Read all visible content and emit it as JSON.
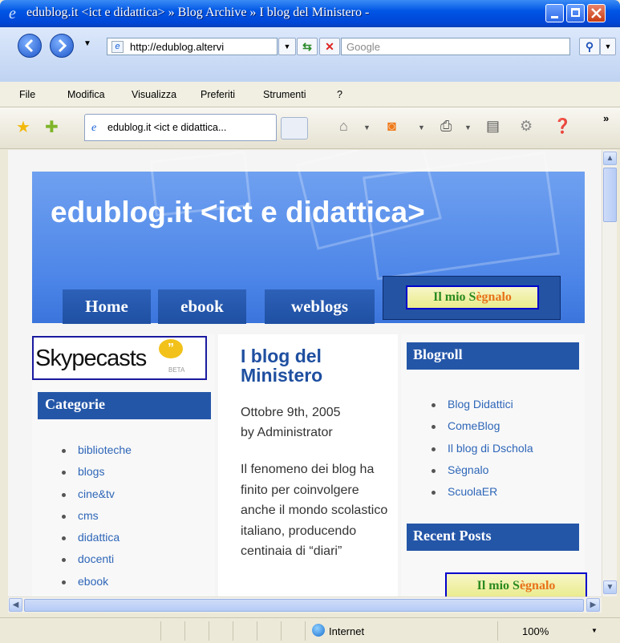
{
  "window": {
    "title": "edublog.it <ict e didattica> » Blog Archive » I blog del Ministero -"
  },
  "address_bar": {
    "url": "http://edublog.altervi",
    "search_placeholder": "Google"
  },
  "menu": [
    "File",
    "Modifica",
    "Visualizza",
    "Preferiti",
    "Strumenti",
    "?"
  ],
  "tab": {
    "label": "edublog.it <ict e didattica..."
  },
  "page": {
    "site_title": "edublog.it <ict e didattica>",
    "nav": [
      "Home",
      "ebook",
      "weblogs"
    ],
    "signalo": {
      "part1": "Il mio S",
      "part2": "ègnalo"
    },
    "skype": {
      "text": "Skypecasts",
      "beta": "BETA"
    },
    "categories_title": "Categorie",
    "categories": [
      "biblioteche",
      "blogs",
      "cine&tv",
      "cms",
      "didattica",
      "docenti",
      "ebook"
    ],
    "post": {
      "title": "I blog del Ministero",
      "date": "Ottobre 9th, 2005",
      "author": "by Administrator",
      "body": "Il fenomeno dei blog ha finito per coinvolgere anche il mondo scolastico italiano, producendo centinaia di “diari”"
    },
    "blogroll_title": "Blogroll",
    "blogroll": [
      "Blog Didattici",
      "ComeBlog",
      "Il blog di Dschola",
      "Sègnalo",
      "ScuolaER"
    ],
    "recent_posts_title": "Recent Posts"
  },
  "status": {
    "zone": "Internet",
    "zoom": "100%"
  },
  "colors": {
    "titlebar": "#0055e5",
    "header_blue": "#4d86e8",
    "nav_blue": "#2456a8",
    "link": "#2e66b8"
  }
}
